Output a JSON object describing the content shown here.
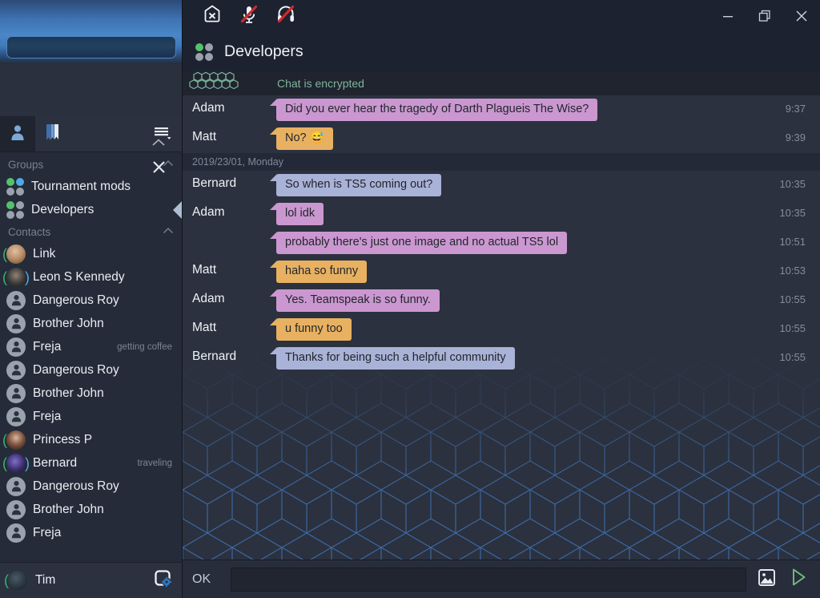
{
  "window": {
    "controls": {
      "minimize": "—",
      "maximize": "❐",
      "close": "✕"
    }
  },
  "toolbar": {
    "icons": [
      {
        "name": "disconnect-icon",
        "title": "Disconnect"
      },
      {
        "name": "microphone-muted-icon",
        "title": "Microphone muted"
      },
      {
        "name": "headphones-muted-icon",
        "title": "Sound muted"
      }
    ]
  },
  "sidebar": {
    "close_label": "✕",
    "collapse_label": "⌃",
    "tabs": [
      {
        "name": "contacts-tab",
        "icon": "person-icon",
        "active": true
      },
      {
        "name": "bookmarks-tab",
        "icon": "bookmark-icon",
        "active": false
      },
      {
        "name": "menu-tab",
        "icon": "list-menu-icon",
        "active": false
      }
    ],
    "sections": [
      {
        "label": "Groups",
        "chevron": "⌃",
        "items": [
          {
            "name": "Tournament mods",
            "icon": "group-icon",
            "dots": [
              "green",
              "blue",
              "gray",
              "gray"
            ],
            "active": false
          },
          {
            "name": "Developers",
            "icon": "group-icon",
            "dots": [
              "green",
              "gray",
              "gray",
              "gray"
            ],
            "active": true
          }
        ]
      },
      {
        "label": "Contacts",
        "chevron": "⌃",
        "items": [
          {
            "name": "Link",
            "avatar": "photo",
            "photo": "link",
            "talking": "left",
            "status": ""
          },
          {
            "name": "Leon S Kennedy",
            "avatar": "photo",
            "photo": "leon",
            "talking": "both",
            "status": ""
          },
          {
            "name": "Dangerous Roy",
            "avatar": "generic",
            "talking": "none",
            "status": ""
          },
          {
            "name": "Brother John",
            "avatar": "generic",
            "talking": "none",
            "status": ""
          },
          {
            "name": "Freja",
            "avatar": "generic",
            "talking": "none",
            "status": "getting coffee"
          },
          {
            "name": "Dangerous Roy",
            "avatar": "generic",
            "talking": "none",
            "status": ""
          },
          {
            "name": "Brother John",
            "avatar": "generic",
            "talking": "none",
            "status": ""
          },
          {
            "name": "Freja",
            "avatar": "generic",
            "talking": "none",
            "status": ""
          },
          {
            "name": "Princess P",
            "avatar": "photo",
            "photo": "princess",
            "talking": "left",
            "status": ""
          },
          {
            "name": "Bernard",
            "avatar": "photo",
            "photo": "bernard",
            "talking": "both",
            "status": "traveling"
          },
          {
            "name": "Dangerous Roy",
            "avatar": "generic",
            "talking": "none",
            "status": ""
          },
          {
            "name": "Brother John",
            "avatar": "generic",
            "talking": "none",
            "status": ""
          },
          {
            "name": "Freja",
            "avatar": "generic",
            "talking": "none",
            "status": ""
          }
        ]
      }
    ],
    "user": {
      "name": "Tim",
      "avatar": "photo",
      "talking": "left",
      "settings_icon": "gear-icon"
    }
  },
  "channel": {
    "title": "Developers",
    "icon": "group-icon",
    "dots": [
      "green",
      "gray",
      "gray",
      "gray"
    ]
  },
  "chat": {
    "encrypted_banner": {
      "label": "Chat is encrypted",
      "icon": "honeycomb-icon"
    },
    "date_divider": "2019/23/01, Monday",
    "messages_before_divider": [
      {
        "author": "Adam",
        "text": "Did you ever hear the tragedy of Darth Plagueis The Wise?",
        "time": "9:37",
        "color": "#cb97d0"
      },
      {
        "author": "Matt",
        "text": "No? 😅",
        "time": "9:39",
        "color": "#e8b161"
      }
    ],
    "messages_after_divider": [
      {
        "author": "Bernard",
        "text": "So when is TS5 coming out?",
        "time": "10:35",
        "color": "#a9b2d7"
      },
      {
        "author": "Adam",
        "text": "lol idk",
        "time": "10:35",
        "color": "#cb97d0"
      },
      {
        "author": "",
        "text": "probably there's just one image and no actual TS5 lol",
        "time": "10:51",
        "color": "#cb97d0"
      },
      {
        "author": "Matt",
        "text": "haha so funny",
        "time": "10:53",
        "color": "#e8b161"
      },
      {
        "author": "Adam",
        "text": "Yes. Teamspeak is so funny.",
        "time": "10:55",
        "color": "#cb97d0"
      },
      {
        "author": "Matt",
        "text": "u funny too",
        "time": "10:55",
        "color": "#e8b161"
      },
      {
        "author": "Bernard",
        "text": "Thanks for being such a helpful community",
        "time": "10:55",
        "color": "#a9b2d7"
      }
    ]
  },
  "input": {
    "ok_label": "OK",
    "value": "",
    "placeholder": "",
    "attach_icon": "image-icon",
    "send_icon": "send-triangle-icon"
  },
  "colors": {
    "accent_green": "#55c26a",
    "accent_blue": "#4fa8e8",
    "bubble_adam": "#cb97d0",
    "bubble_matt": "#e8b161",
    "bubble_bernard": "#a9b2d7",
    "encrypted_text": "#7fb499"
  }
}
